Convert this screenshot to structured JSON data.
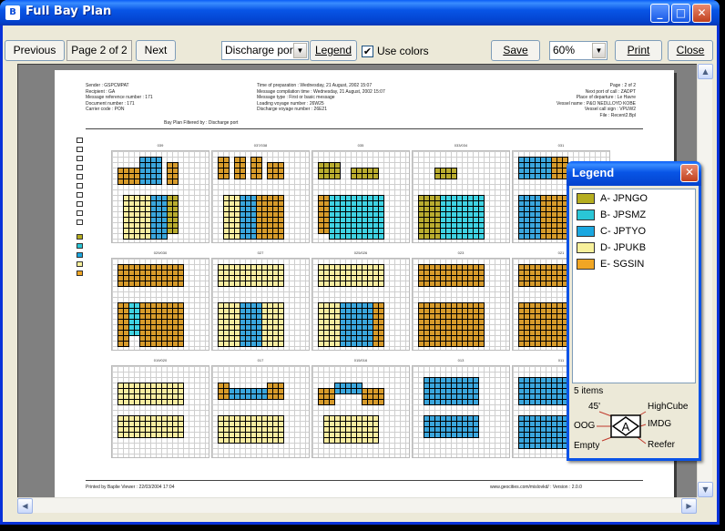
{
  "window": {
    "title": "Full Bay Plan",
    "icon_letter": "B",
    "minimize": "_",
    "maximize": "□",
    "close": "✕"
  },
  "toolbar": {
    "previous_label": "Previous",
    "page_indicator": "Page 2 of 2",
    "next_label": "Next",
    "discharge_select": "Discharge port",
    "legend_label": "Legend",
    "use_colors_label": "Use colors",
    "use_colors_checked": true,
    "save_label": "Save",
    "zoom_value": "60%",
    "print_label": "Print",
    "close_label": "Close"
  },
  "report": {
    "header_left": "Sender : GSPCMPAT\nRecipient : GA\nMessage reference number : 171\nDocument number : 171\nCarrier code : PON",
    "header_mid": "Time of preparation : Wednesday, 21 August, 2002 15:07\nMessage compilation time : Wednesday, 21 August, 2002 15:07\nMessage type : First or basic message\nLoading voyage number : 26W25\nDischarge voyage number : 26E21",
    "header_right": "Page : 2 of 2\nNext port of call : ZADPT\nPlace of departure : Le Havre\nVessel name : P&O NEDLLOYD KOBE\nVessel call sign : VPUW2\nFile : Recent2.Bpl",
    "filter_title": "Bay Plan Filtered by : Discharge port",
    "footer_left": "Printed by Baplie Viewer : 22/03/2004 17:04",
    "footer_right": "www.geocities.com/mislovkd/ : Version : 2.0.0"
  },
  "bays": {
    "labels": [
      "039",
      "037/038",
      "035",
      "033/034",
      "031",
      "029/030",
      "027",
      "025/026",
      "023",
      "021",
      "019/020",
      "017",
      "015/016",
      "013",
      "011"
    ]
  },
  "legend": {
    "title": "Legend",
    "close": "✕",
    "items": [
      {
        "label": "A- JPNGO",
        "color": "#b5ad1f"
      },
      {
        "label": "B- JPSMZ",
        "color": "#2ac6d6"
      },
      {
        "label": "C- JPTYO",
        "color": "#1aa7e0"
      },
      {
        "label": "D- JPUKB",
        "color": "#f7f09b"
      },
      {
        "label": "E- SGSIN",
        "color": "#f1a624"
      }
    ],
    "count": "5 items",
    "symbol": {
      "letter": "A",
      "top_left": "45'",
      "top_right": "HighCube",
      "left": "OOG",
      "right": "IMDG",
      "bottom_left": "Empty",
      "bottom_right": "Reefer"
    }
  },
  "colors": {
    "ocher": "#d79b2b",
    "blue": "#3aa6dd",
    "cyan": "#3fd3e3",
    "pale": "#f7eca0",
    "olive": "#b9ac2f"
  }
}
